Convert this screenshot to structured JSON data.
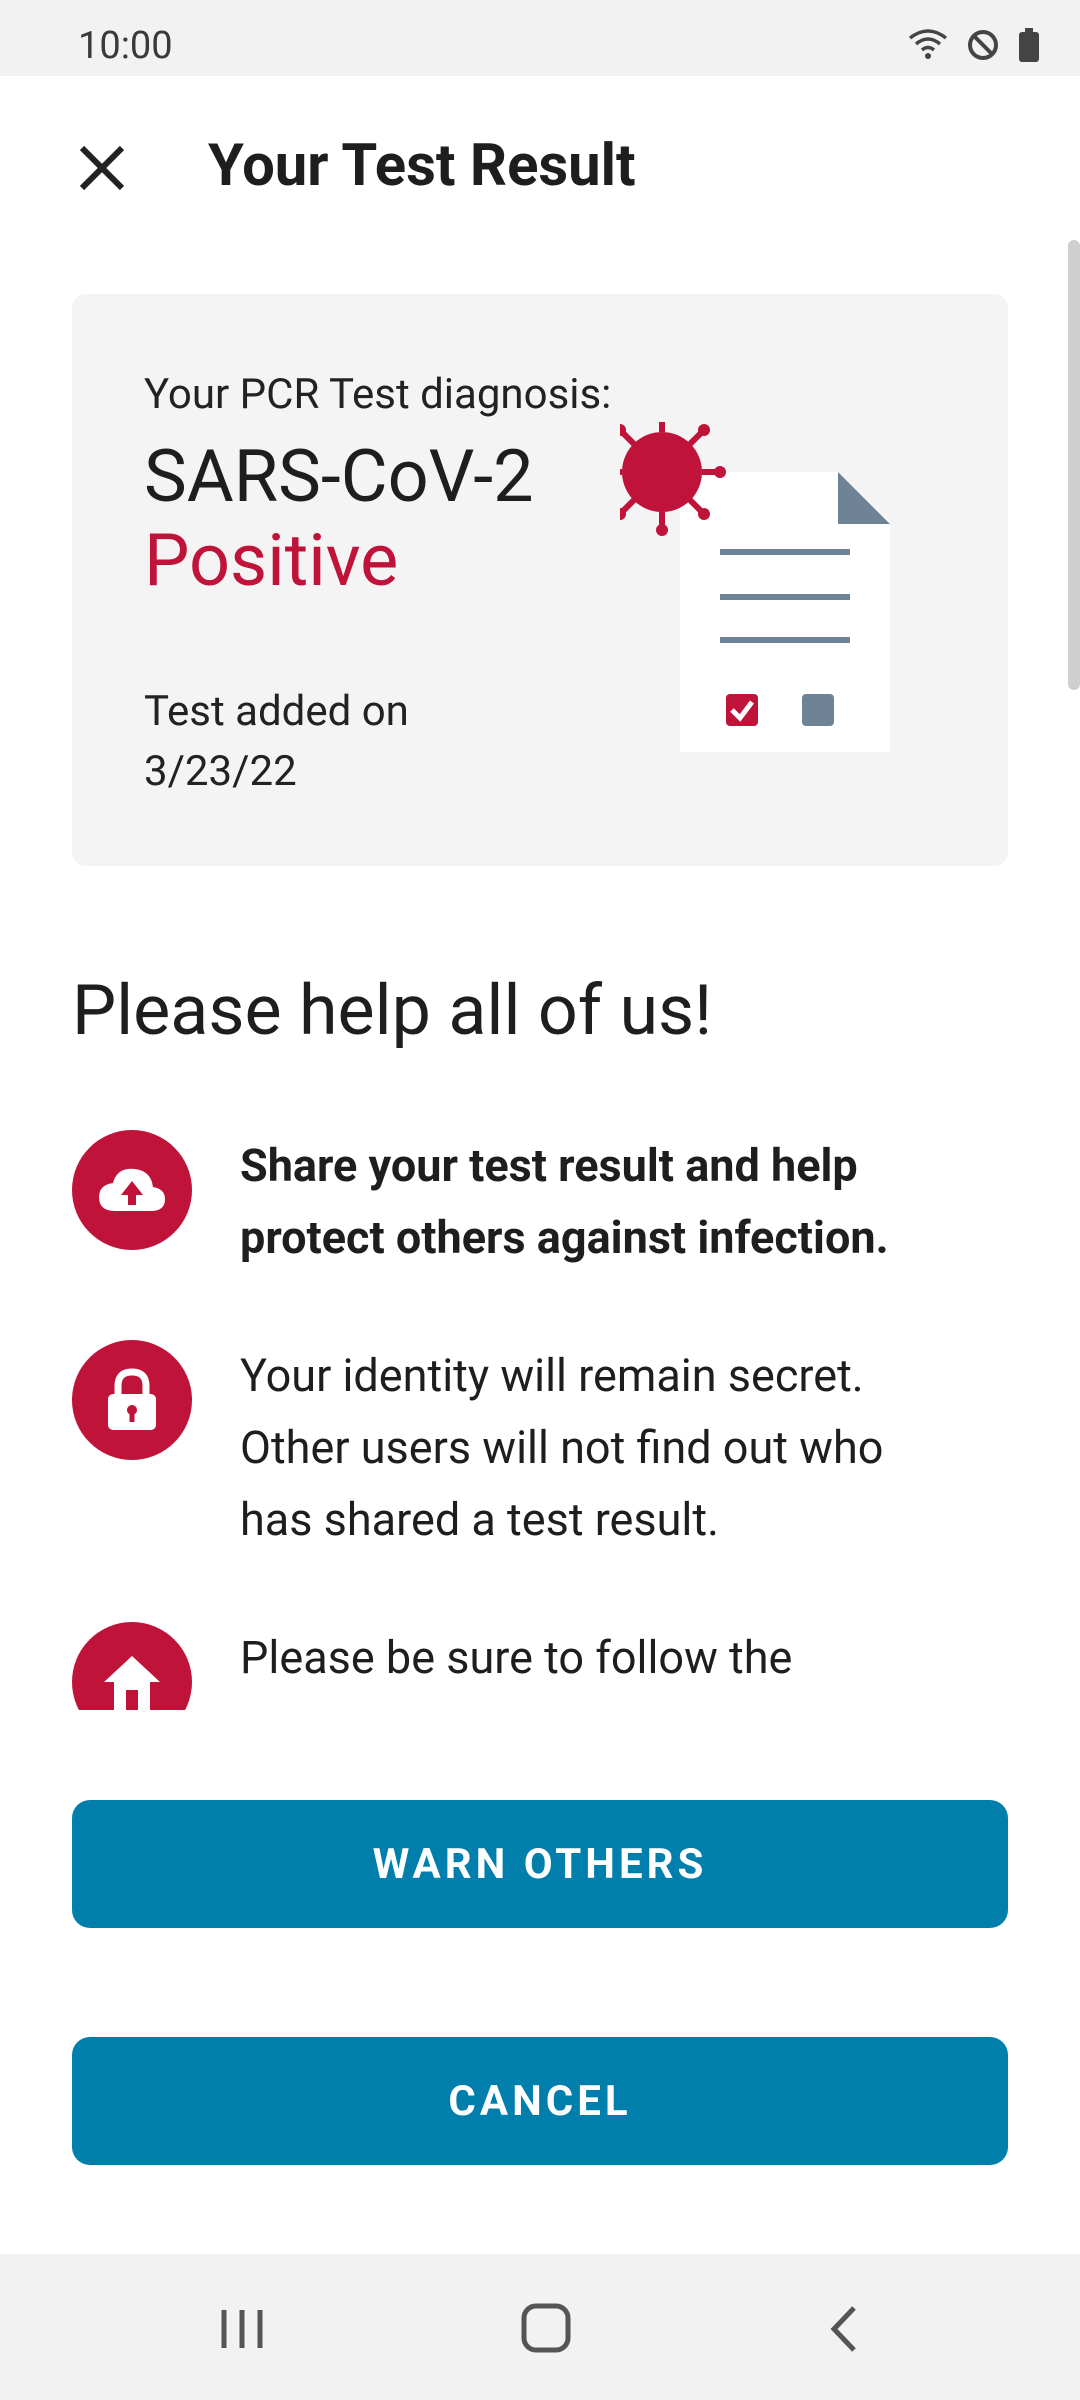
{
  "status": {
    "time": "10:00"
  },
  "header": {
    "title": "Your Test Result"
  },
  "result": {
    "diagnosis_label": "Your PCR Test diagnosis:",
    "diagnosis_name": "SARS-CoV-2",
    "diagnosis_result": "Positive",
    "added_label": "Test added on",
    "added_date": "3/23/22"
  },
  "help": {
    "title": "Please help all of us!",
    "items": [
      {
        "icon": "cloud-upload-icon",
        "text": "Share your test result and help protect others against infection."
      },
      {
        "icon": "lock-icon",
        "text": "Your identity will remain secret. Other users will not find out who has shared a test result."
      },
      {
        "icon": "home-icon",
        "text": "Please be sure to follow the instructions from your public health authority."
      }
    ]
  },
  "buttons": {
    "warn": "WARN OTHERS",
    "cancel": "CANCEL"
  },
  "colors": {
    "accent": "#c0133a",
    "primary": "#007fad",
    "card": "#f4f4f4"
  }
}
